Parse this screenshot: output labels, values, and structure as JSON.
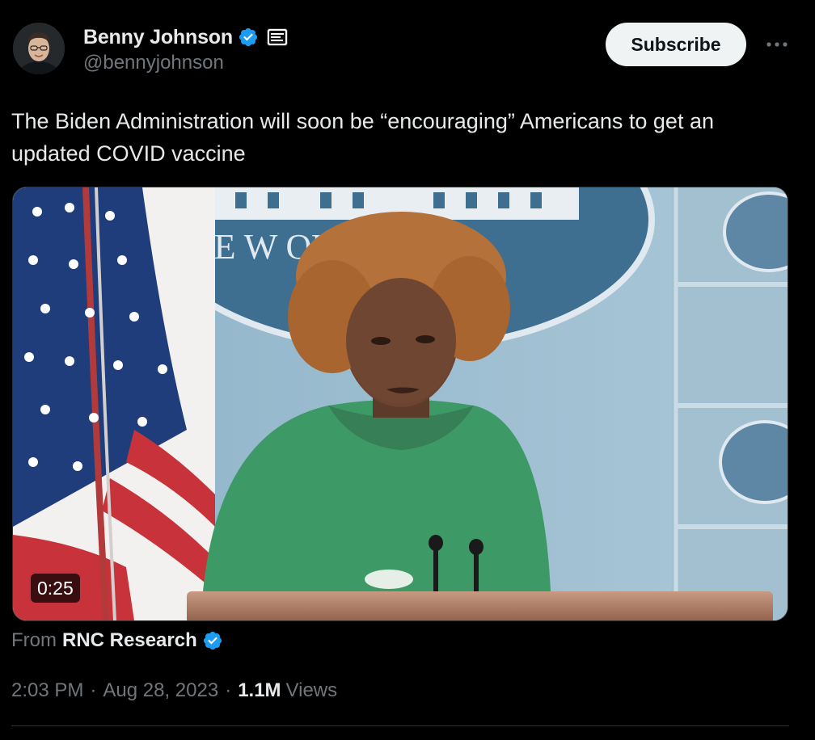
{
  "author": {
    "display_name": "Benny Johnson",
    "handle": "@bennyjohnson",
    "verified": true,
    "affiliate_badge": "news-badge-icon"
  },
  "header": {
    "subscribe_label": "Subscribe",
    "more_icon": "more-horizontal-icon"
  },
  "tweet": {
    "text": "The Biden Administration will soon be “encouraging” Americans to get an updated COVID vaccine"
  },
  "media": {
    "type": "video",
    "duration": "0:25",
    "backdrop_text": "THE W      OUSE"
  },
  "attribution": {
    "from_label": "From",
    "source": "RNC Research",
    "verified": true
  },
  "meta": {
    "time": "2:03 PM",
    "separator": "·",
    "date": "Aug 28, 2023",
    "views_count": "1.1M",
    "views_label": "Views"
  },
  "colors": {
    "background": "#000000",
    "verified_blue": "#1d9bf0",
    "text_primary": "#e7e9ea",
    "text_secondary": "#71767b",
    "subscribe_bg": "#eff3f4"
  }
}
